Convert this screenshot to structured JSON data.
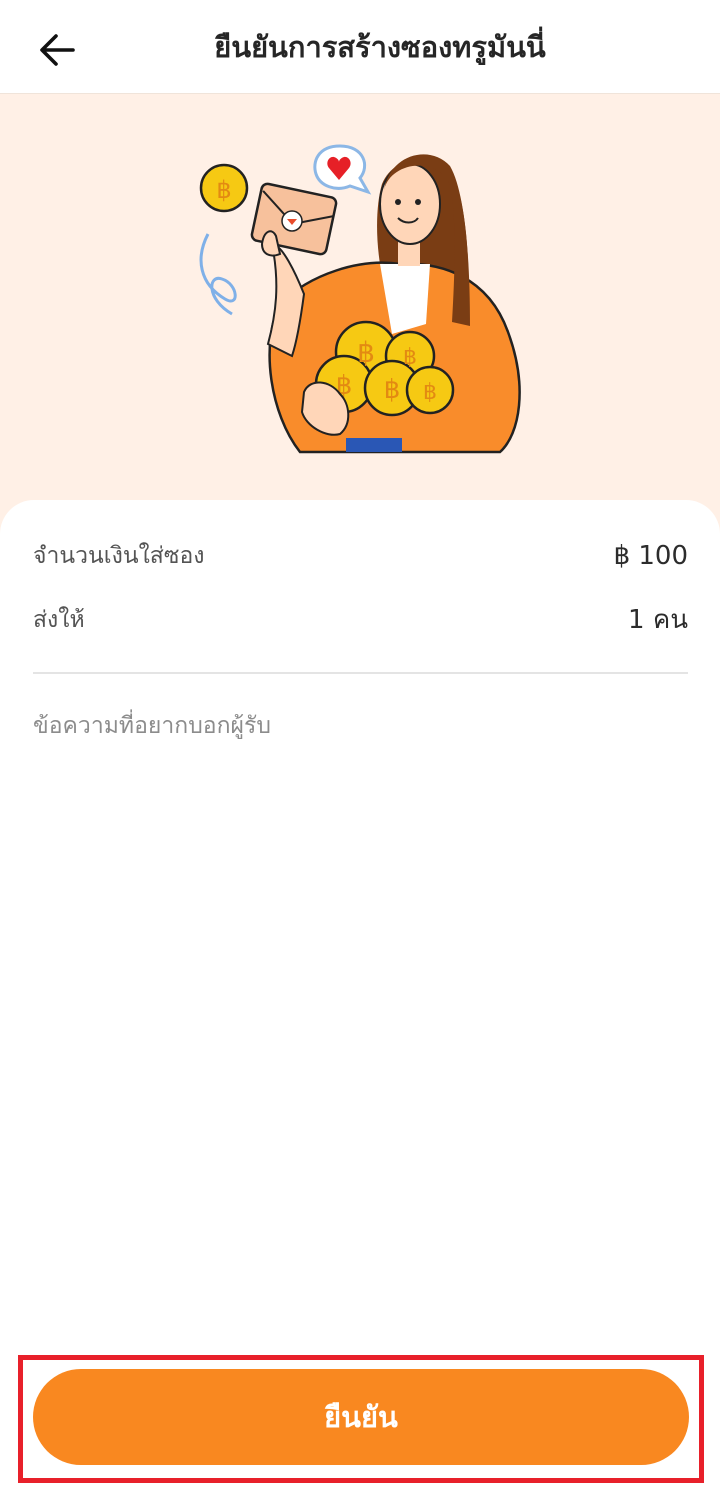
{
  "header": {
    "title": "ยืนยันการสร้างซองทรูมันนี่",
    "back_icon": "arrow-left-icon"
  },
  "summary": {
    "amount_label": "จำนวนเงินใส่ซอง",
    "amount_value": "฿ 100",
    "recipients_label": "ส่งให้",
    "recipients_value": "1 คน"
  },
  "message": {
    "placeholder": "ข้อความที่อยากบอกผู้รับ"
  },
  "confirm_button": {
    "label": "ยืนยัน"
  },
  "colors": {
    "accent": "#f98820",
    "hero_background": "#fff0e6",
    "highlight_border": "#e8202a"
  }
}
